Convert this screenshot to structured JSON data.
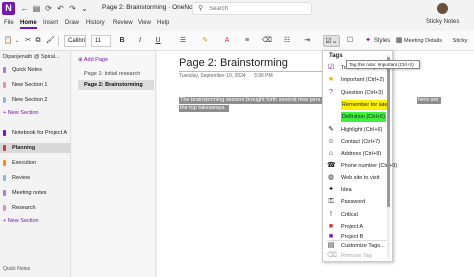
{
  "titlebar": {
    "window_title": "Page 2: Brainstorming · OneNote",
    "search_placeholder": "Search",
    "app_icon_letter": "N"
  },
  "menu": {
    "tabs": [
      "File",
      "Home",
      "Insert",
      "Draw",
      "History",
      "Review",
      "View",
      "Help"
    ],
    "active_tab": "Home",
    "sticky_notes": "Sticky Notes"
  },
  "ribbon": {
    "font_name": "Calibri",
    "font_size": "11",
    "bold": "B",
    "italic": "I",
    "underline": "U",
    "styles_label": "Styles",
    "meeting_details": "Meeting Details",
    "sticky": "Sticky"
  },
  "notebook": {
    "name": "Dipanjenath @ Spiral...",
    "sections": [
      {
        "label": "Quick Notes",
        "color": "#a77ad9"
      },
      {
        "label": "New Section 1",
        "color": "#e58fb4"
      },
      {
        "label": "New Section 2",
        "color": "#8ab7e8"
      }
    ],
    "add_section": "+ New Section",
    "project_notebook": "Notebook for Project A",
    "project_sections": [
      {
        "label": "Planning",
        "color": "#d13438",
        "selected": true
      },
      {
        "label": "Execution",
        "color": "#ff8c00"
      },
      {
        "label": "Review",
        "color": "#8ab7e8"
      },
      {
        "label": "Meeting notes",
        "color": "#a77ad9"
      },
      {
        "label": "Research",
        "color": "#e58fb4"
      }
    ],
    "add_section_2": "+ New Section",
    "footer": "Quick Notes"
  },
  "pages": {
    "add_page": "Add Page",
    "items": [
      {
        "label": "Page 1: Initial research",
        "selected": false
      },
      {
        "label": "Page 2: Brainstorming",
        "selected": true
      }
    ]
  },
  "canvas": {
    "title": "Page 2: Brainstorming",
    "date": "Tuesday, September 10, 2024",
    "time": "3:36 PM",
    "note_line1": "The brainstorming session brought forth several new pers",
    "note_line1_tail": "here are",
    "note_line2": "the top takeaways."
  },
  "tags_menu": {
    "header": "Tags",
    "tooltip": "Tag this note: Important (Ctrl+2)",
    "items": [
      {
        "label": "To Do (Ctrl+1)",
        "icon": "checkbox-icon",
        "glyph": "☑",
        "color": "#7719aa"
      },
      {
        "label": "Important (Ctrl+2)",
        "icon": "star-icon",
        "glyph": "★",
        "color": "#f0a30a"
      },
      {
        "label": "Question (Ctrl+3)",
        "icon": "question-icon",
        "glyph": "?",
        "color": "#7719aa"
      },
      {
        "label": "Remember for later",
        "icon": "highlight-yellow-icon",
        "glyph": "",
        "color": "#222",
        "highlight": "yellow"
      },
      {
        "label": "Definition (Ctrl+5)",
        "icon": "highlight-green-icon",
        "glyph": "",
        "color": "#222",
        "highlight": "green"
      },
      {
        "label": "Highlight (Ctrl+6)",
        "icon": "pen-icon",
        "glyph": "✎",
        "color": "#444"
      },
      {
        "label": "Contact (Ctrl+7)",
        "icon": "contact-icon",
        "glyph": "☺",
        "color": "#444"
      },
      {
        "label": "Address (Ctrl+8)",
        "icon": "home-icon",
        "glyph": "⌂",
        "color": "#444"
      },
      {
        "label": "Phone number (Ctrl+9)",
        "icon": "phone-icon",
        "glyph": "☎",
        "color": "#444"
      },
      {
        "label": "Web site to visit",
        "icon": "globe-icon",
        "glyph": "◍",
        "color": "#444"
      },
      {
        "label": "Idea",
        "icon": "lightbulb-icon",
        "glyph": "✦",
        "color": "#444"
      },
      {
        "label": "Password",
        "icon": "lock-icon",
        "glyph": "⚿",
        "color": "#444"
      },
      {
        "label": "Critical",
        "icon": "exclamation-icon",
        "glyph": "!",
        "color": "#444"
      },
      {
        "label": "Project A",
        "icon": "project-a-icon",
        "glyph": "■",
        "color": "#d13438"
      },
      {
        "label": "Project B",
        "icon": "project-b-icon",
        "glyph": "■",
        "color": "#7719aa"
      }
    ],
    "customize": "Customize Tags...",
    "remove": "Remove Tag"
  }
}
